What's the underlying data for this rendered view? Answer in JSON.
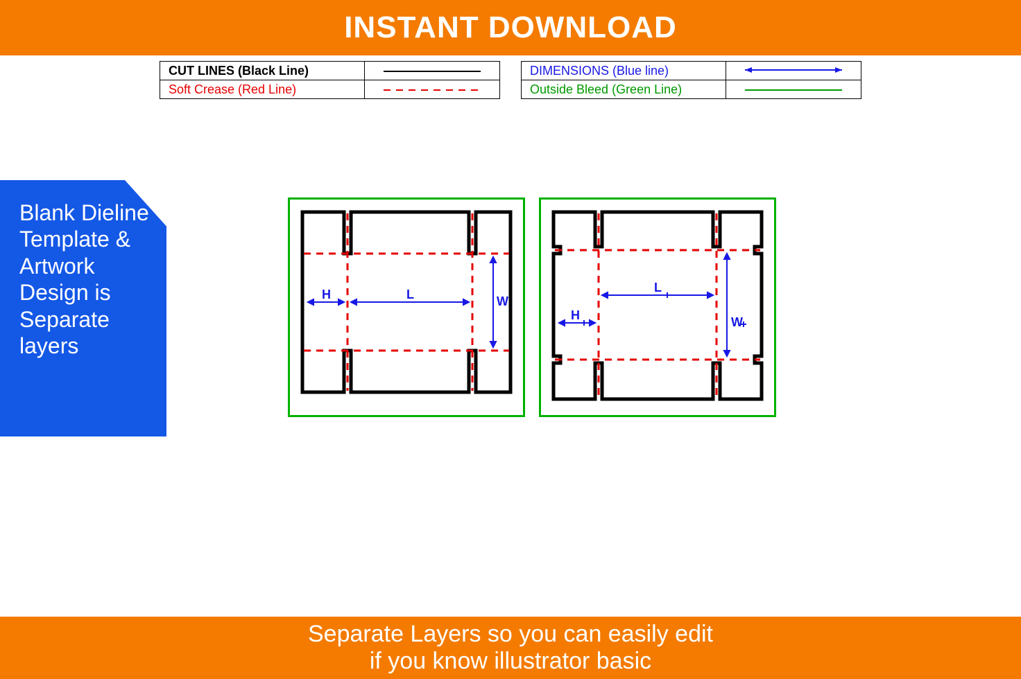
{
  "top_banner": "INSTANT DOWNLOAD",
  "legend": {
    "cut": "CUT LINES (Black Line)",
    "crease": "Soft Crease (Red Line)",
    "dimensions": "DIMENSIONS (Blue line)",
    "bleed": "Outside Bleed (Green Line)"
  },
  "side_banner": "Blank Dieline Template & Artwork Design is Separate layers",
  "diagram_labels": {
    "H": "H",
    "L": "L",
    "W": "W",
    "H2": "H",
    "L2": "L",
    "W2": "W"
  },
  "footer_line1": "Separate Layers so you can easily edit",
  "footer_line2": "if you know illustrator basic"
}
